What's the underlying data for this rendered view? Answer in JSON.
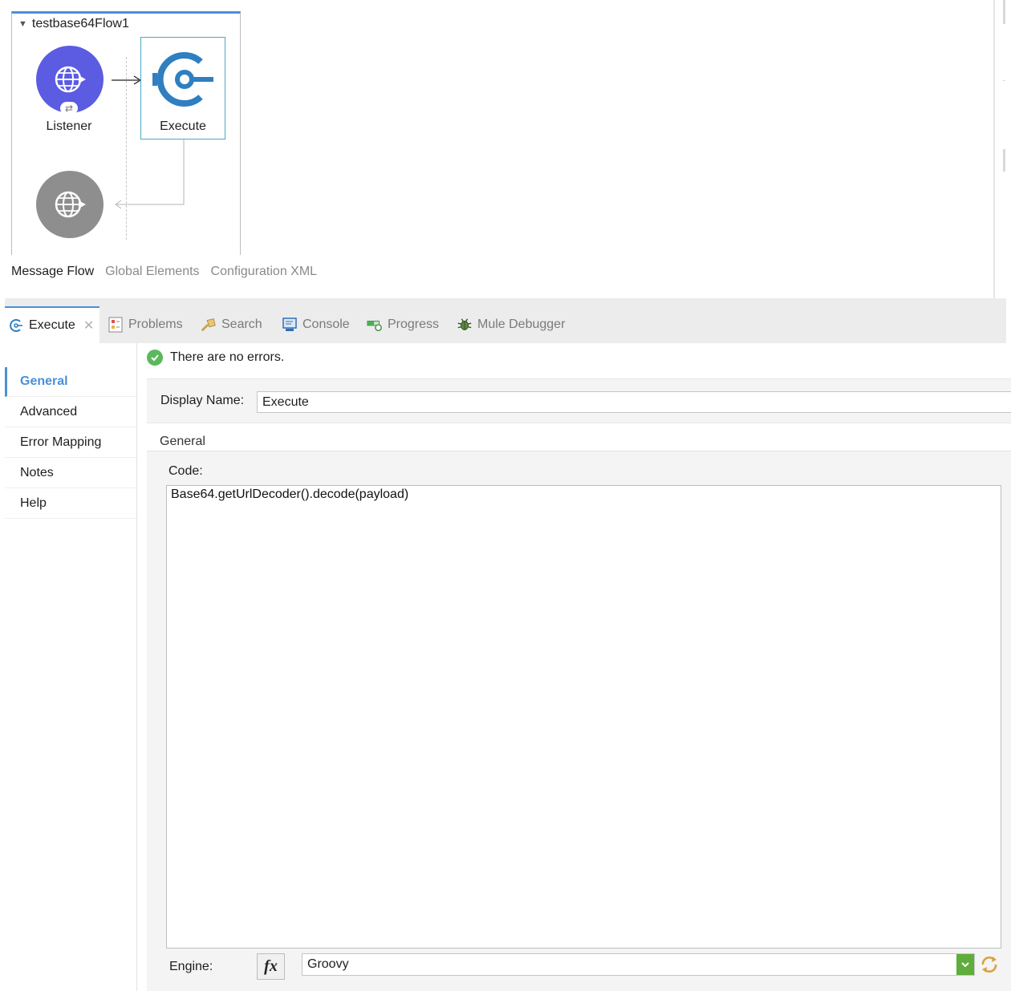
{
  "flow": {
    "name": "testbase64Flow1",
    "listener_label": "Listener",
    "execute_label": "Execute"
  },
  "editor_tabs": [
    {
      "label": "Message Flow",
      "active": true
    },
    {
      "label": "Global Elements",
      "active": false
    },
    {
      "label": "Configuration XML",
      "active": false
    }
  ],
  "view_tabs": [
    {
      "label": "Execute",
      "icon": "execute-icon",
      "active": true
    },
    {
      "label": "Problems",
      "icon": "problems-icon",
      "active": false
    },
    {
      "label": "Search",
      "icon": "search-icon",
      "active": false
    },
    {
      "label": "Console",
      "icon": "console-icon",
      "active": false
    },
    {
      "label": "Progress",
      "icon": "progress-icon",
      "active": false
    },
    {
      "label": "Mule Debugger",
      "icon": "debugger-icon",
      "active": false
    }
  ],
  "side_nav": [
    {
      "label": "General",
      "active": true
    },
    {
      "label": "Advanced",
      "active": false
    },
    {
      "label": "Error Mapping",
      "active": false
    },
    {
      "label": "Notes",
      "active": false
    },
    {
      "label": "Help",
      "active": false
    }
  ],
  "status": {
    "message": "There are no errors."
  },
  "display_name": {
    "label": "Display Name:",
    "value": "Execute"
  },
  "general_section": {
    "header": "General",
    "code_label": "Code:",
    "code_value": "Base64.getUrlDecoder().decode(payload)",
    "engine_label": "Engine:",
    "fx_label": "fx",
    "engine_value": "Groovy"
  },
  "colors": {
    "accent": "#4a90d9",
    "listener": "#5b5ce2",
    "response": "#8e8e8e",
    "execute_icon": "#2f7fc1",
    "ok": "#5cb85c",
    "select_arrow": "#5fae3b"
  }
}
